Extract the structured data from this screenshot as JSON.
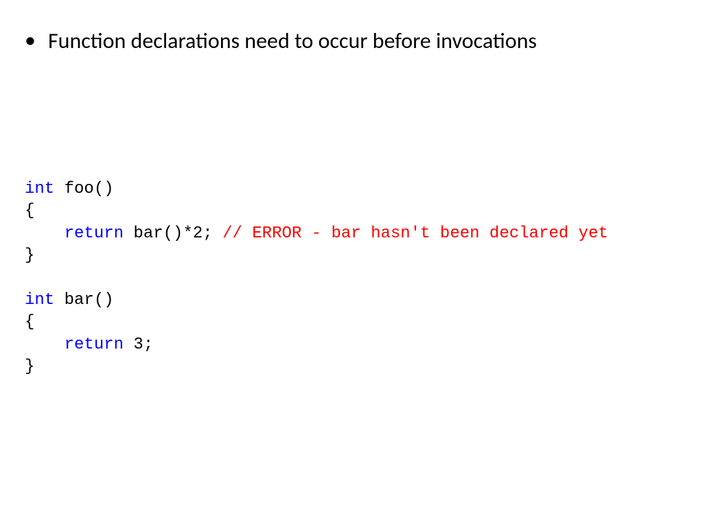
{
  "bullet": {
    "marker": "•",
    "text": "Function declarations need to occur before invocations"
  },
  "code": {
    "kw_int": "int",
    "kw_return": "return",
    "foo_sig": " foo()",
    "brace_open": "{",
    "brace_close": "}",
    "foo_body_return_suffix": " bar()*2; ",
    "error_comment": "// ERROR - bar hasn't been declared yet",
    "bar_sig": " bar()",
    "bar_body_return_suffix": " 3;",
    "indent": "    "
  }
}
